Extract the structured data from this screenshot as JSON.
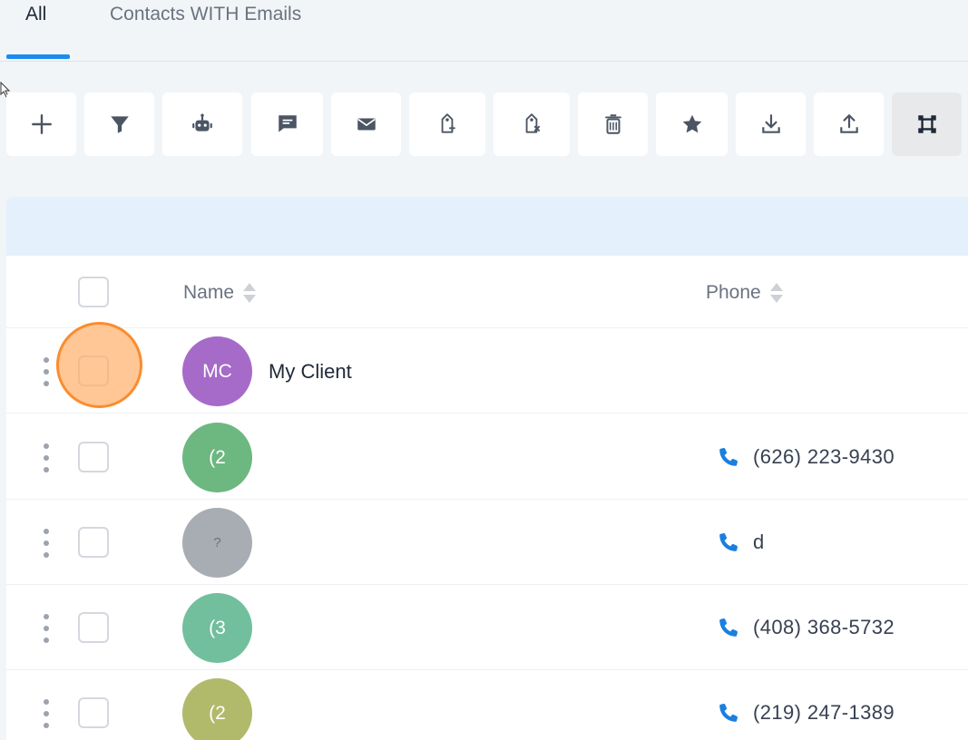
{
  "tabs": [
    {
      "label": "All",
      "active": true
    },
    {
      "label": "Contacts WITH Emails",
      "active": false
    }
  ],
  "toolbar": {
    "buttons": [
      {
        "icon": "plus-icon"
      },
      {
        "icon": "filter-icon"
      },
      {
        "icon": "robot-icon"
      },
      {
        "icon": "message-icon"
      },
      {
        "icon": "email-icon"
      },
      {
        "icon": "add-tag-icon"
      },
      {
        "icon": "remove-tag-icon"
      },
      {
        "icon": "trash-icon"
      },
      {
        "icon": "star-icon"
      },
      {
        "icon": "download-icon"
      },
      {
        "icon": "upload-icon"
      },
      {
        "icon": "merge-icon"
      }
    ]
  },
  "table": {
    "columns": [
      {
        "label": "Name"
      },
      {
        "label": "Phone"
      }
    ],
    "rows": [
      {
        "initials": "MC",
        "name": "My Client",
        "phone": "",
        "avatar_color": "#a66bc9"
      },
      {
        "initials": "(2",
        "name": "",
        "phone": "(626) 223-9430",
        "avatar_color": "#6db781"
      },
      {
        "initials": "?",
        "name": "",
        "phone": "d",
        "avatar_color": "#a8acb3"
      },
      {
        "initials": "(3",
        "name": "",
        "phone": "(408) 368-5732",
        "avatar_color": "#72bf9d"
      },
      {
        "initials": "(2",
        "name": "",
        "phone": "(219) 247-1389",
        "avatar_color": "#b1ba6b"
      }
    ]
  },
  "colors": {
    "accent": "#1a8cf0",
    "phone_icon": "#1a7fe0",
    "highlight": "#fb8c2e"
  }
}
